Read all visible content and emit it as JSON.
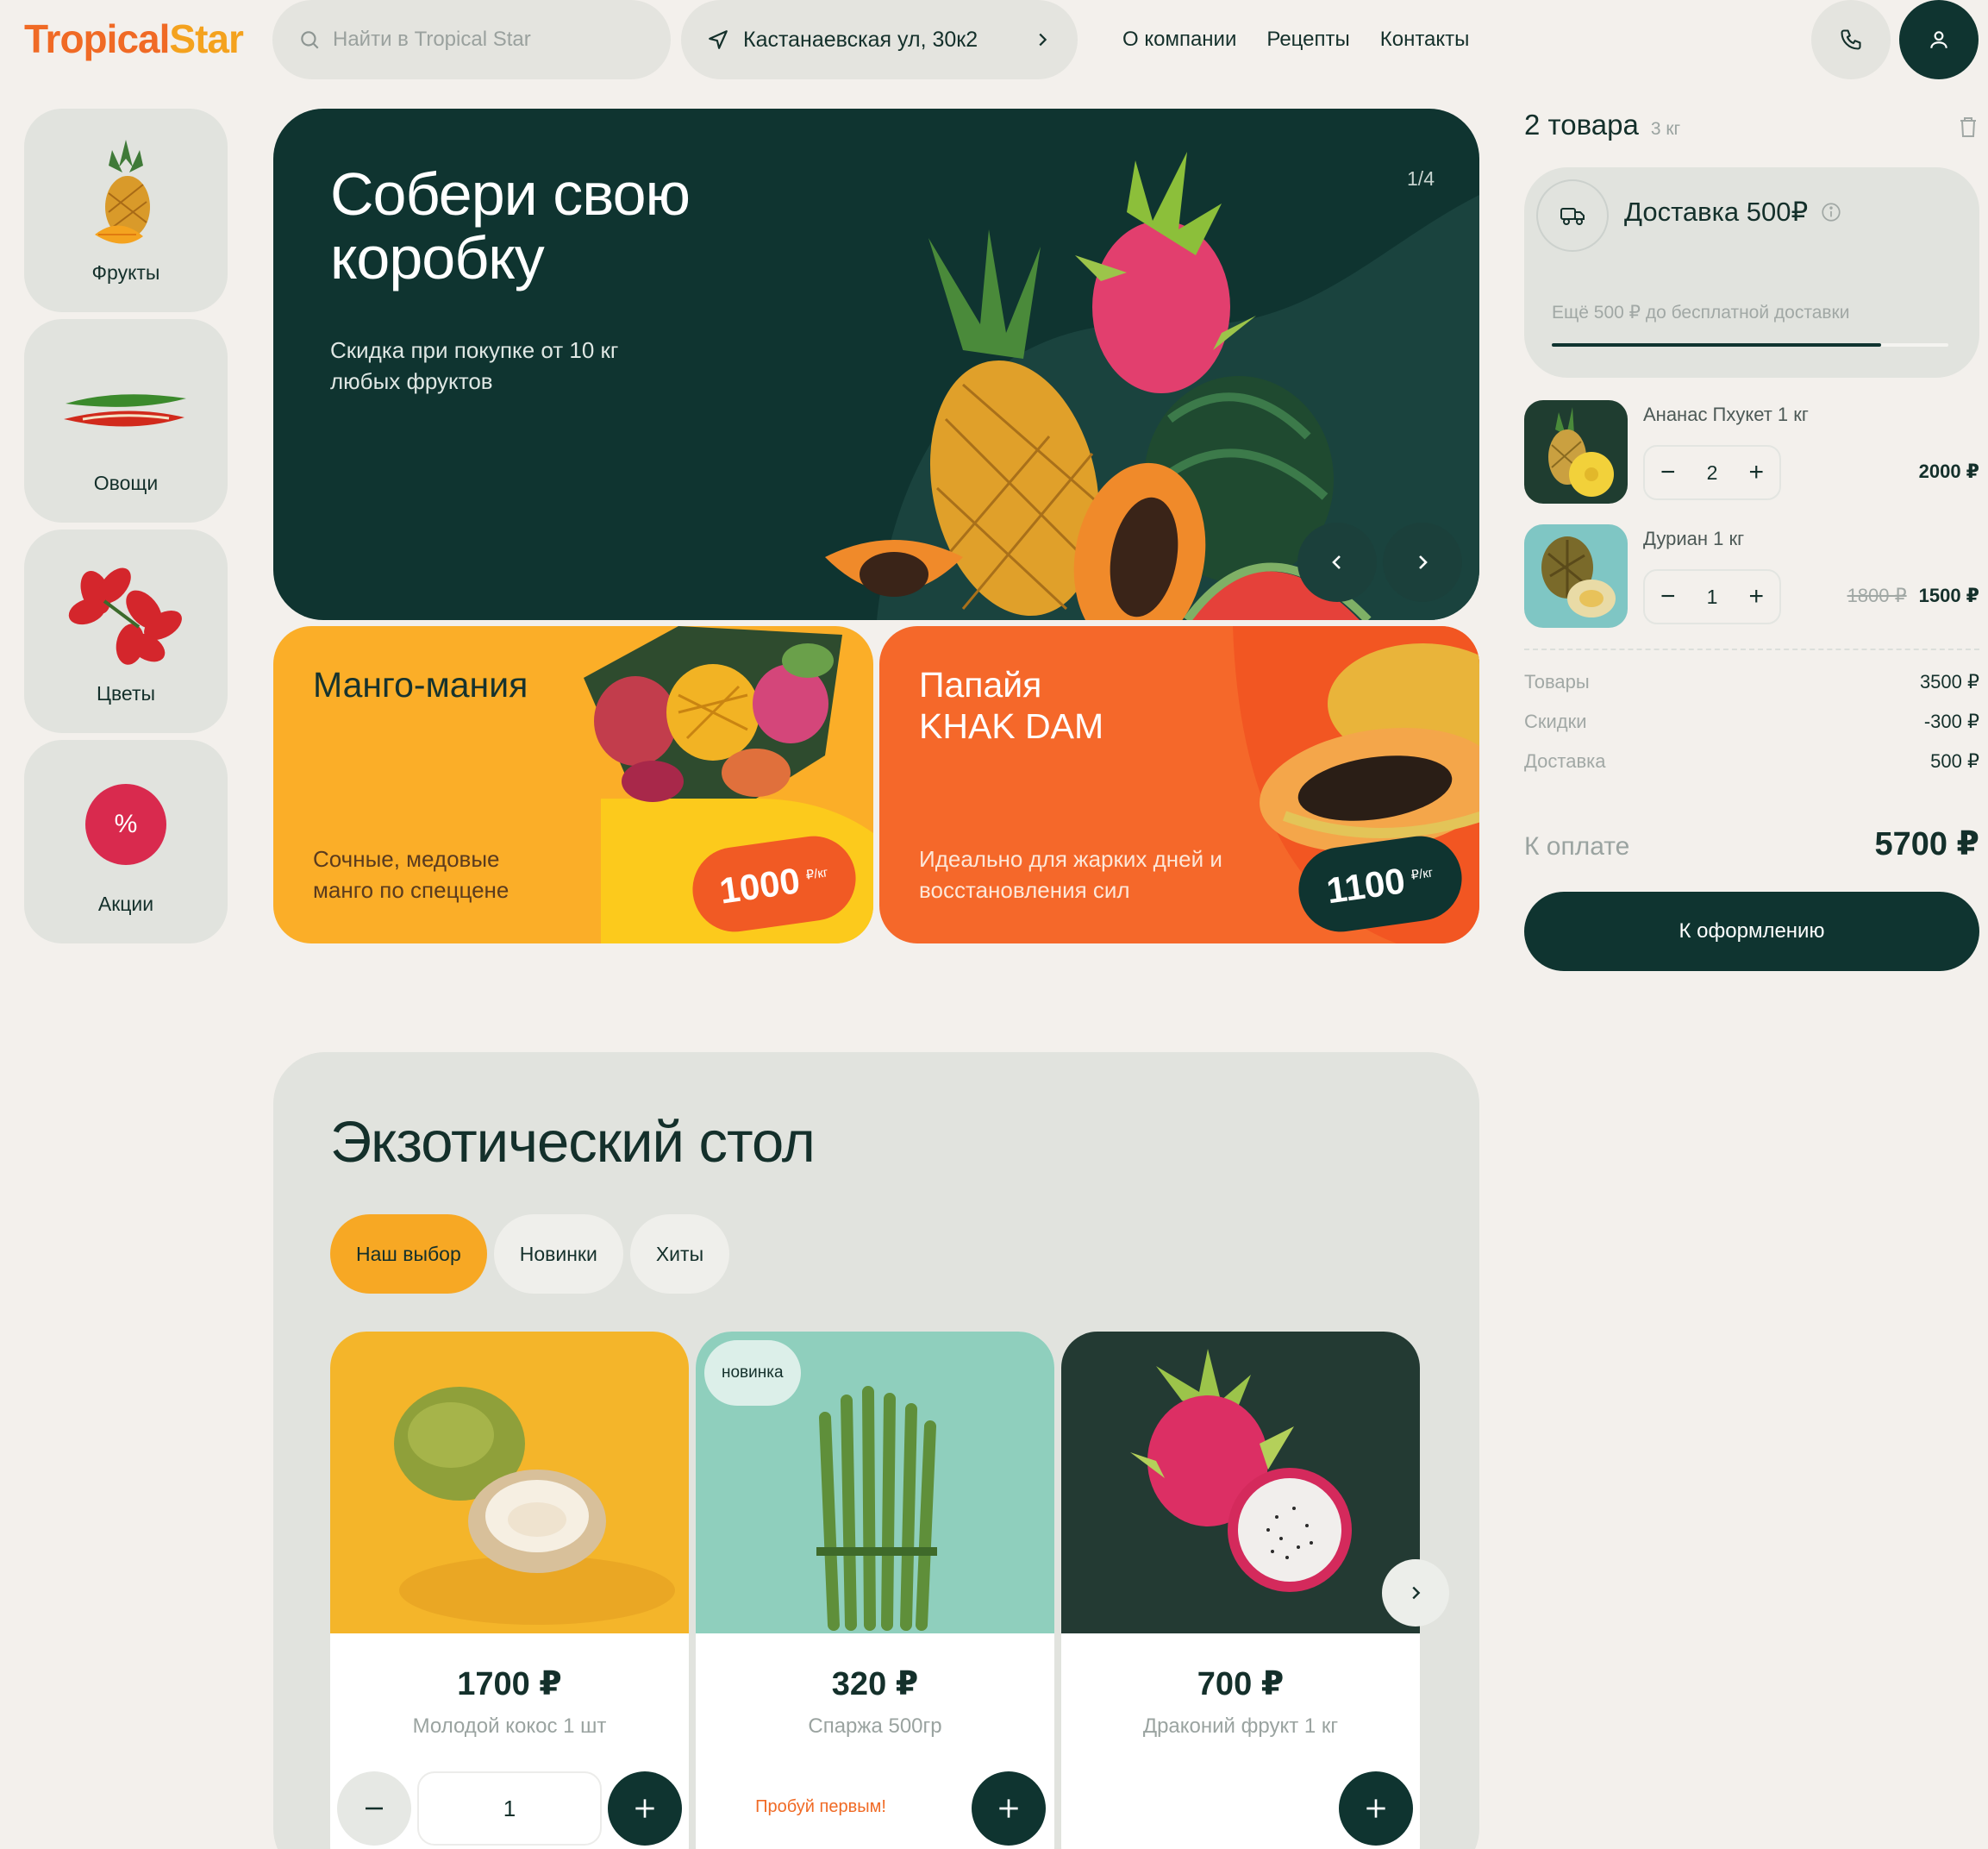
{
  "brand": {
    "logo_part1": "Tropical",
    "logo_part2": "Star"
  },
  "header": {
    "search_placeholder": "Найти в Tropical Star",
    "address": "Кастанаевская ул, 30к2",
    "nav": [
      "О компании",
      "Рецепты",
      "Контакты"
    ]
  },
  "categories": [
    {
      "label": "Фрукты",
      "icon": "pineapple-mango"
    },
    {
      "label": "Овощи",
      "icon": "chili-peppers"
    },
    {
      "label": "Цветы",
      "icon": "red-flowers"
    },
    {
      "label": "Акции",
      "icon": "percent-badge",
      "badge_text": "%"
    }
  ],
  "hero": {
    "title": "Собери свою коробку",
    "subtitle": "Скидка при покупке от 10 кг любых фруктов",
    "page_indicator": "1/4"
  },
  "promos": [
    {
      "title": "Манго-мания",
      "desc": "Сочные, медовые манго по спеццене",
      "price": "1000",
      "unit": "₽/кг",
      "bg": "#fbae28"
    },
    {
      "title": "Папайя\nKHAK DAM",
      "desc": "Идеально для жарких дней и восстановления сил",
      "price": "1100",
      "unit": "₽/кг",
      "bg": "#f5682a"
    }
  ],
  "cart": {
    "count": "2 товара",
    "weight": "3 кг",
    "delivery_title": "Доставка 500₽",
    "delivery_note": "Ещё 500 ₽ до бесплатной доставки",
    "delivery_progress": 0.83,
    "items": [
      {
        "name": "Ананас Пхукет 1 кг",
        "qty": "2",
        "price": "2000 ₽",
        "old_price": ""
      },
      {
        "name": "Дуриан 1 кг",
        "qty": "1",
        "price": "1500 ₽",
        "old_price": "1800 ₽"
      }
    ],
    "summary": [
      {
        "label": "Товары",
        "value": "3500 ₽"
      },
      {
        "label": "Скидки",
        "value": "-300 ₽"
      },
      {
        "label": "Доставка",
        "value": "500 ₽"
      }
    ],
    "total_label": "К оплате",
    "total_value": "5700 ₽",
    "checkout_label": "К оформлению"
  },
  "exotic": {
    "title": "Экзотический стол",
    "tabs": [
      "Наш выбор",
      "Новинки",
      "Хиты"
    ],
    "active_tab": 0,
    "products": [
      {
        "price": "1700 ₽",
        "name": "Молодой кокос 1 шт",
        "qty": "1",
        "bg": "#f4b52a"
      },
      {
        "price": "320 ₽",
        "name": "Спаржа 500гр",
        "badge": "новинка",
        "promo_text": "Пробуй первым!",
        "bg": "#8fcfbd"
      },
      {
        "price": "700 ₽",
        "name": "Драконий фрукт 1 кг",
        "bg": "#233a33"
      }
    ]
  },
  "colors": {
    "primary": "#0f3430",
    "accent_orange": "#f06a25",
    "accent_yellow": "#f7a824",
    "background": "#f3f0ec",
    "card": "#e1e3de"
  }
}
